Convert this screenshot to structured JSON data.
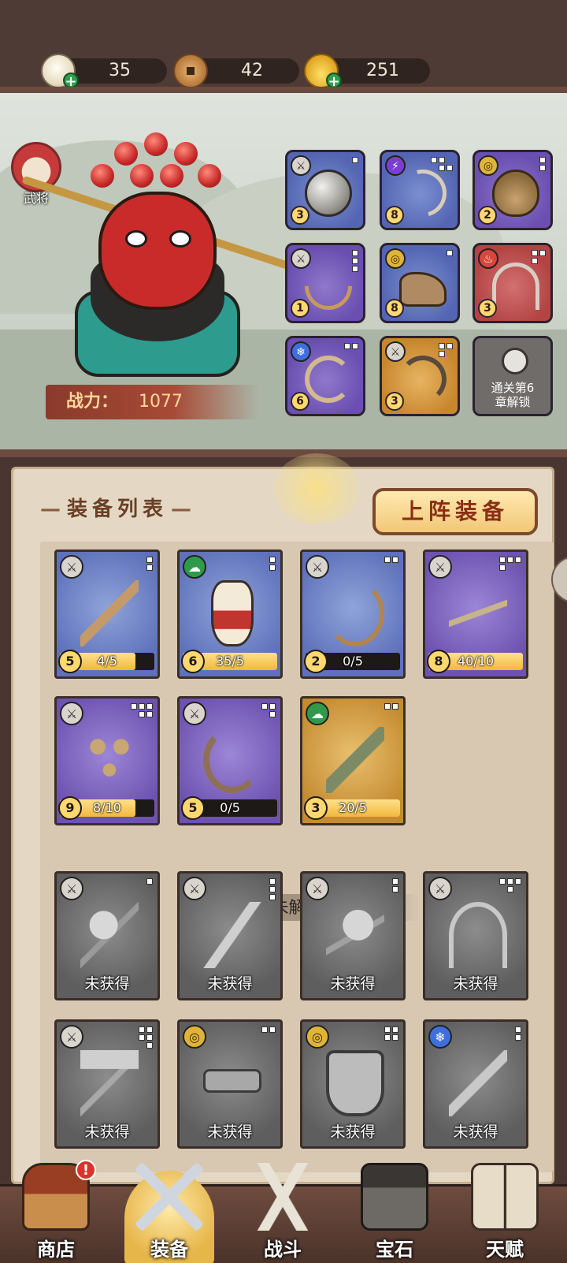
{
  "resources": {
    "bun": {
      "value": "35",
      "icon": "steamed-bun-icon"
    },
    "coin": {
      "value": "42",
      "icon": "copper-coin-icon"
    },
    "ingot": {
      "value": "251",
      "icon": "gold-ingot-icon"
    },
    "plus_symbol": "+"
  },
  "hero": {
    "class_label": "武将",
    "power_label": "战力：",
    "power_value": "1077"
  },
  "equipped": [
    {
      "type": "sword-icon",
      "glyph": "⚔",
      "level": "3",
      "rarity": "blue",
      "item": "iron-ball"
    },
    {
      "type": "lightning-icon",
      "glyph": "⚡",
      "level": "8",
      "rarity": "blue",
      "item": "whip"
    },
    {
      "type": "target-icon",
      "glyph": "◎",
      "level": "2",
      "rarity": "purple",
      "item": "gourd"
    },
    {
      "type": "sword-icon",
      "glyph": "⚔",
      "level": "1",
      "rarity": "purple",
      "item": "bow"
    },
    {
      "type": "target-icon",
      "glyph": "◎",
      "level": "8",
      "rarity": "blue",
      "item": "boot"
    },
    {
      "type": "fire-icon",
      "glyph": "♨",
      "level": "3",
      "rarity": "red",
      "item": "crossbow"
    },
    {
      "type": "snowflake-icon",
      "glyph": "❄",
      "level": "6",
      "rarity": "purple",
      "item": "hook"
    },
    {
      "type": "sword-icon",
      "glyph": "⚔",
      "level": "3",
      "rarity": "gold",
      "item": "sickle"
    }
  ],
  "locked_slot": {
    "text_line1": "通关第6",
    "text_line2": "章解锁"
  },
  "list": {
    "title": "装备列表",
    "deploy_button": "上阵装备",
    "owned": [
      {
        "badge": "sword-icon",
        "glyph": "⚔",
        "level": "5",
        "progress": "4/5",
        "fraction": 0.8,
        "rarity": "blue",
        "art": "sword"
      },
      {
        "badge": "poison-icon",
        "glyph": "☁",
        "level": "6",
        "progress": "35/5",
        "fraction": 1.0,
        "rarity": "blue",
        "art": "bottle"
      },
      {
        "badge": "sword-icon",
        "glyph": "⚔",
        "level": "2",
        "progress": "0/5",
        "fraction": 0.0,
        "rarity": "blue",
        "art": "dao"
      },
      {
        "badge": "sword-icon",
        "glyph": "⚔",
        "level": "8",
        "progress": "40/10",
        "fraction": 1.0,
        "rarity": "purple",
        "art": "spear"
      },
      {
        "badge": "sword-icon",
        "glyph": "⚔",
        "level": "9",
        "progress": "8/10",
        "fraction": 0.8,
        "rarity": "purple",
        "art": "caltrops"
      },
      {
        "badge": "sword-icon",
        "glyph": "⚔",
        "level": "5",
        "progress": "0/5",
        "fraction": 0.0,
        "rarity": "purple",
        "art": "boomerang"
      },
      {
        "badge": "poison-icon",
        "glyph": "☁",
        "level": "3",
        "progress": "20/5",
        "fraction": 1.0,
        "rarity": "gold",
        "art": "poisondagger"
      }
    ],
    "locked_header": "未解锁",
    "locked": [
      {
        "badge": "sword-icon",
        "glyph": "⚔",
        "label": "未获得",
        "art": "mace"
      },
      {
        "badge": "sword-icon",
        "glyph": "⚔",
        "label": "未获得",
        "art": "glaive"
      },
      {
        "badge": "sword-icon",
        "glyph": "⚔",
        "label": "未获得",
        "art": "axe"
      },
      {
        "badge": "sword-icon",
        "glyph": "⚔",
        "label": "未获得",
        "art": "xbow"
      },
      {
        "badge": "sword-icon",
        "glyph": "⚔",
        "label": "未获得",
        "art": "hammer"
      },
      {
        "badge": "target-icon",
        "glyph": "◎",
        "label": "未获得",
        "art": "belt"
      },
      {
        "badge": "target-icon",
        "glyph": "◎",
        "label": "未获得",
        "art": "shield"
      },
      {
        "badge": "snowflake-icon",
        "glyph": "❄",
        "label": "未获得",
        "art": "flute"
      }
    ]
  },
  "nav": {
    "shop": "商店",
    "equip": "装备",
    "battle": "战斗",
    "gem": "宝石",
    "talent": "天赋",
    "alert": "!"
  },
  "colors": {
    "blue_rarity": "#5e71ba",
    "purple_rarity": "#6d52b0",
    "gold_rarity": "#c58b30",
    "red_rarity": "#b44444",
    "progress_fill": "#f1b83d"
  }
}
